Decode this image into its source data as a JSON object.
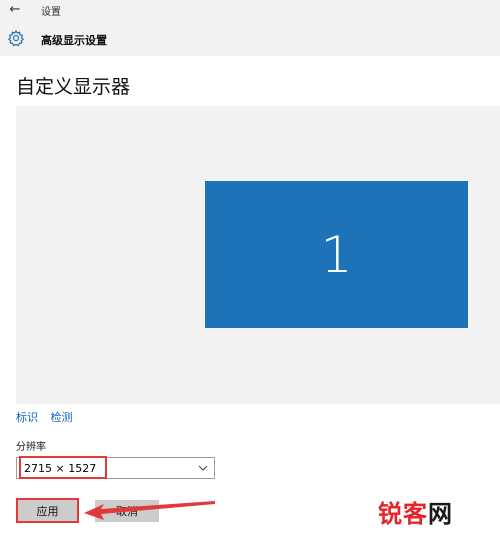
{
  "window": {
    "title": "设置",
    "back_label": "←"
  },
  "header": {
    "title": "高级显示设置",
    "icon": "gear-icon"
  },
  "section": {
    "title": "自定义显示器"
  },
  "preview": {
    "monitor_number": "1",
    "monitor_color": "#1e73b8"
  },
  "links": {
    "identify": "标识",
    "detect": "检测"
  },
  "resolution": {
    "label": "分辨率",
    "value": "2715 × 1527"
  },
  "buttons": {
    "apply": "应用",
    "cancel": "取消"
  },
  "annotation": {
    "color": "#e23a3a"
  },
  "watermark": {
    "part1": "锐客",
    "part2": "网"
  }
}
